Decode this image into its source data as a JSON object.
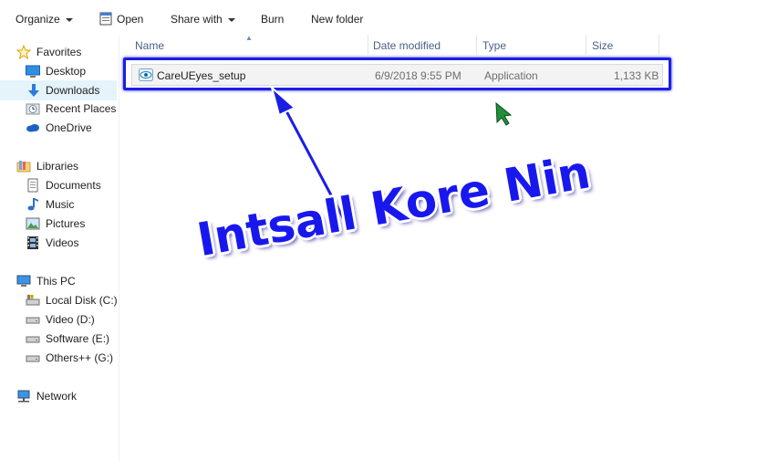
{
  "toolbar": {
    "organize_label": "Organize",
    "open_label": "Open",
    "share_label": "Share with",
    "burn_label": "Burn",
    "new_folder_label": "New folder"
  },
  "nav": {
    "favorites": "Favorites",
    "desktop": "Desktop",
    "downloads": "Downloads",
    "recent": "Recent Places",
    "onedrive": "OneDrive",
    "libraries": "Libraries",
    "documents": "Documents",
    "music": "Music",
    "pictures": "Pictures",
    "videos": "Videos",
    "this_pc": "This PC",
    "local_c": "Local Disk (C:)",
    "video_d": "Video (D:)",
    "software_e": "Software (E:)",
    "others_g": "Others++ (G:)",
    "network": "Network"
  },
  "columns": {
    "name": "Name",
    "date": "Date modified",
    "type": "Type",
    "size": "Size"
  },
  "files": [
    {
      "name": "CareUEyes_setup",
      "date": "6/9/2018 9:55 PM",
      "type": "Application",
      "size": "1,133 KB",
      "icon": "eye-icon"
    }
  ],
  "annotation": {
    "text": "Intsall Kore Nin",
    "color": "#1818ee"
  },
  "icons": {
    "favorites": "star-icon",
    "desktop": "desktop-icon",
    "downloads": "download-arrow-icon",
    "recent": "recent-places-icon",
    "onedrive": "cloud-icon",
    "libraries": "library-icon",
    "documents": "document-icon",
    "music": "music-note-icon",
    "pictures": "picture-icon",
    "videos": "film-icon",
    "this_pc": "computer-icon",
    "drive": "drive-icon",
    "network": "network-icon"
  }
}
